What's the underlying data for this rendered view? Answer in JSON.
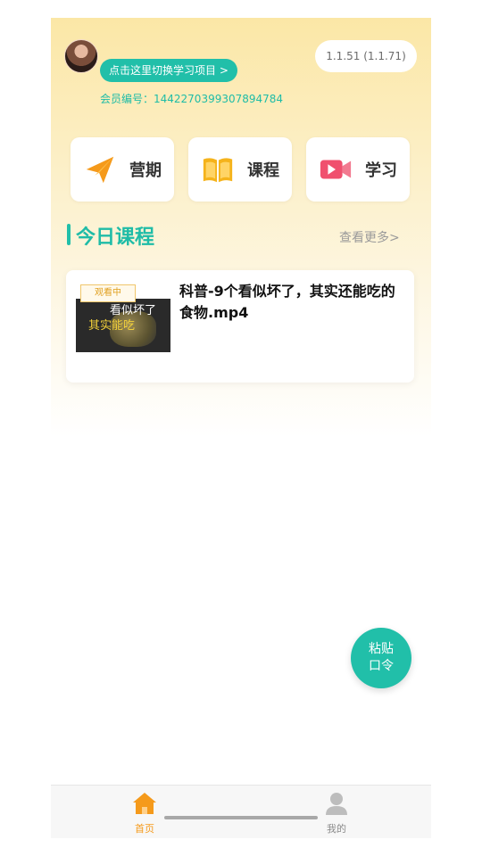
{
  "header": {
    "switch_project": "点击这里切换学习项目 >",
    "member_id": "会员编号：1442270399307894784",
    "version": "1.1.51 (1.1.71)"
  },
  "quick_actions": [
    {
      "label": "营期",
      "icon": "paper-plane-icon"
    },
    {
      "label": "课程",
      "icon": "book-icon"
    },
    {
      "label": "学习",
      "icon": "video-camera-icon"
    }
  ],
  "today": {
    "title": "今日课程",
    "see_more": "查看更多>",
    "course": {
      "badge": "观看中",
      "title": "科普-9个看似坏了，其实还能吃的食物.mp4",
      "thumb_line1": "看似坏了",
      "thumb_line2": "其实能吃"
    }
  },
  "fab": {
    "line1": "粘贴",
    "line2": "口令"
  },
  "tabbar": [
    {
      "label": "首页",
      "icon": "home-icon",
      "active": true
    },
    {
      "label": "我的",
      "icon": "user-icon",
      "active": false
    }
  ],
  "colors": {
    "accent": "#21bfa9",
    "active_tab": "#f59a1b",
    "inactive_tab": "#9e9e9e"
  }
}
